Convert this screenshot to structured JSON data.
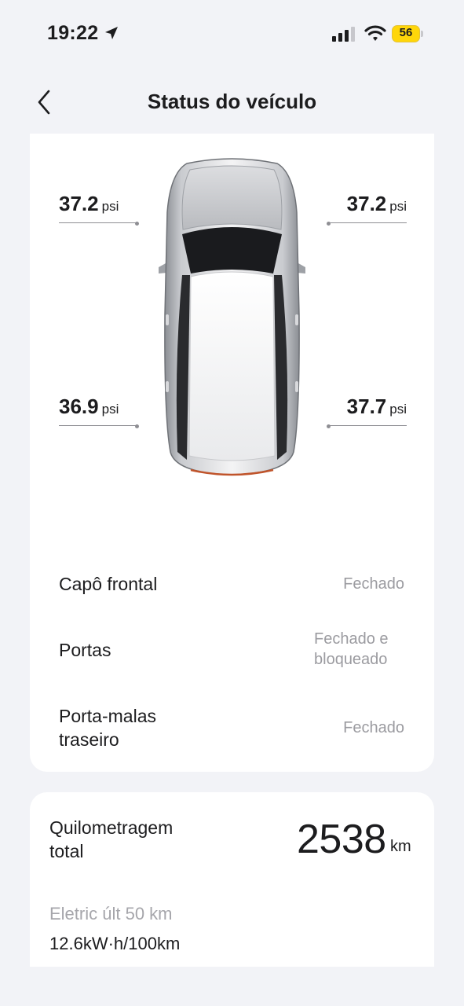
{
  "status_bar": {
    "time": "19:22",
    "battery": "56",
    "location_icon": "location-arrow-icon",
    "signal_icon": "cellular-signal-icon",
    "wifi_icon": "wifi-icon",
    "battery_icon": "battery-icon",
    "battery_color": "#ffd60a"
  },
  "nav": {
    "title": "Status do veículo",
    "back_icon": "chevron-left-icon"
  },
  "tires": {
    "front_left": {
      "value": "37.2",
      "unit": "psi"
    },
    "front_right": {
      "value": "37.2",
      "unit": "psi"
    },
    "rear_left": {
      "value": "36.9",
      "unit": "psi"
    },
    "rear_right": {
      "value": "37.7",
      "unit": "psi"
    }
  },
  "status_rows": [
    {
      "label": "Capô frontal",
      "value": "Fechado"
    },
    {
      "label": "Portas",
      "value": "Fechado e bloqueado"
    },
    {
      "label": "Porta-malas traseiro",
      "value": "Fechado"
    }
  ],
  "mileage": {
    "label": "Quilometragem total",
    "value": "2538",
    "unit": "km",
    "electric_label": "Eletric últ 50 km",
    "electric_value": "12.6kW·h/100km"
  },
  "colors": {
    "background": "#f2f3f7",
    "card": "#ffffff",
    "secondary_text": "#9b9ba0"
  }
}
